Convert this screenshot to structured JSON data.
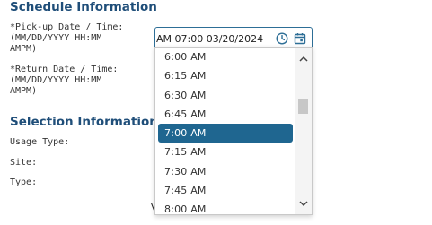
{
  "schedule": {
    "title": "Schedule Information",
    "pickup_label": "*Pick-up Date / Time:\n(MM/DD/YYYY HH:MM\nAMPM)",
    "return_label": "*Return Date / Time:\n(MM/DD/YYYY HH:MM\nAMPM)",
    "pickup_value": "03/20/2024 07:00 AM"
  },
  "selection": {
    "title": "Selection Information",
    "usage_type_label": "Usage Type:",
    "site_label": "Site:",
    "type_label": "Type:",
    "peek_text": "V"
  },
  "time_dropdown": {
    "options": [
      "6:00 AM",
      "6:15 AM",
      "6:30 AM",
      "6:45 AM",
      "7:00 AM",
      "7:15 AM",
      "7:30 AM",
      "7:45 AM",
      "8:00 AM"
    ],
    "selected": "7:00 AM"
  },
  "icons": {
    "time": "clock-icon",
    "date": "calendar-icon",
    "scroll_up": "chevron-up-icon",
    "scroll_down": "chevron-down-icon"
  },
  "colors": {
    "heading": "#1f4e79",
    "selected_bg": "#1f6690",
    "input_border": "#2d6e96"
  }
}
